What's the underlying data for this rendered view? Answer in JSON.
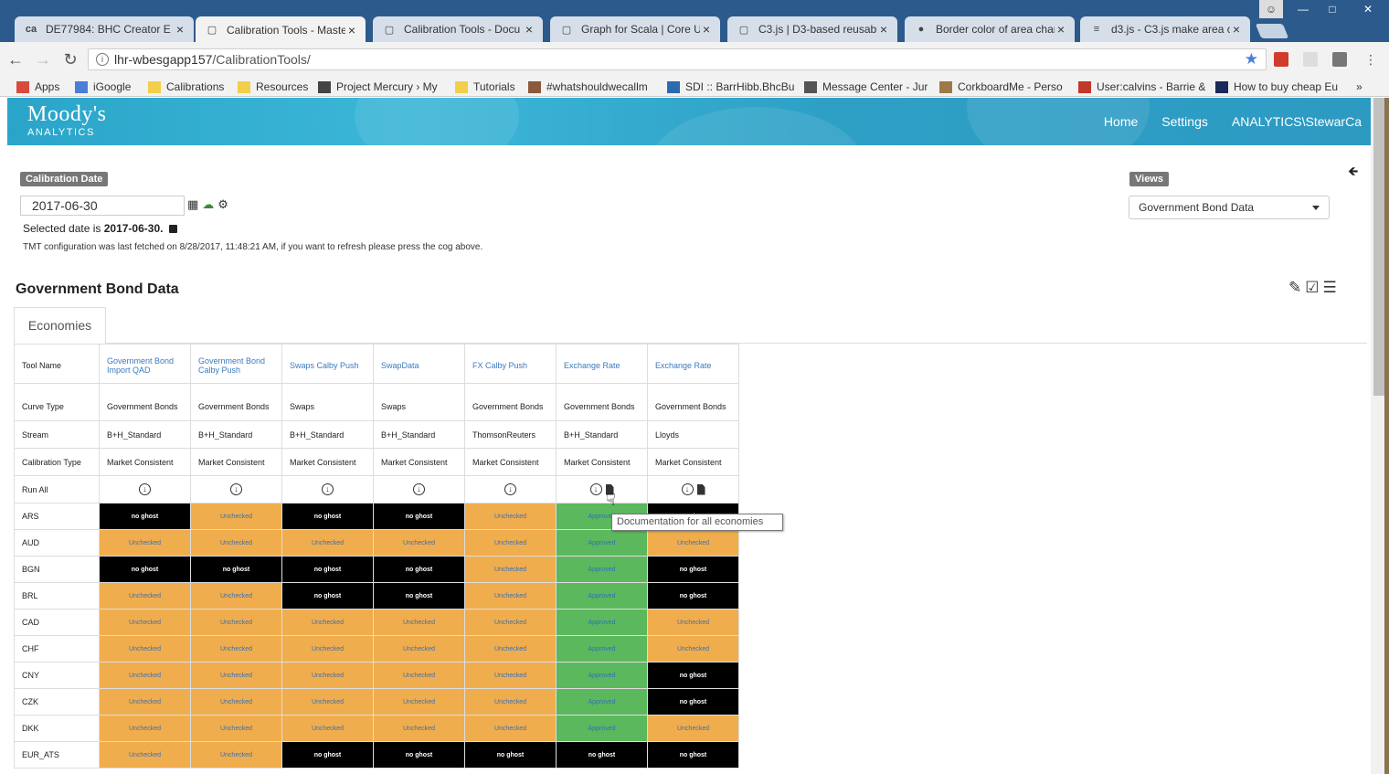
{
  "browser": {
    "tabs": [
      {
        "title": "DE77984: BHC Creator E",
        "icon": "ca-icon",
        "active": false
      },
      {
        "title": "Calibration Tools - Maste",
        "icon": "page-icon",
        "active": true
      },
      {
        "title": "Calibration Tools - Docu",
        "icon": "page-icon",
        "active": false
      },
      {
        "title": "Graph for Scala | Core Us",
        "icon": "page-icon",
        "active": false
      },
      {
        "title": "C3.js | D3-based reusable",
        "icon": "page-icon",
        "active": false
      },
      {
        "title": "Border color of area char",
        "icon": "github-icon",
        "active": false
      },
      {
        "title": "d3.js - C3.js make area cl",
        "icon": "stackoverflow-icon",
        "active": false
      }
    ],
    "url_host": "lhr-wbesgapp157",
    "url_path": "/CalibrationTools/",
    "bookmarks": [
      {
        "label": "Apps",
        "icon": "apps-icon"
      },
      {
        "label": "iGoogle",
        "icon": "google-icon"
      },
      {
        "label": "Calibrations",
        "icon": "folder-icon"
      },
      {
        "label": "Resources",
        "icon": "folder-icon"
      },
      {
        "label": "Project Mercury › My",
        "icon": "ca-icon"
      },
      {
        "label": "Tutorials",
        "icon": "folder-icon"
      },
      {
        "label": "#whatshouldwecallm",
        "icon": "image-icon"
      },
      {
        "label": "SDI :: BarrHibb.BhcBu",
        "icon": "tc-icon"
      },
      {
        "label": "Message Center - Jur",
        "icon": "note-icon"
      },
      {
        "label": "CorkboardMe - Perso",
        "icon": "cork-icon"
      },
      {
        "label": "User:calvins - Barrie &",
        "icon": "user-icon"
      },
      {
        "label": "How to buy cheap Eu",
        "icon": "seat61-icon"
      }
    ],
    "bookmarks_more": "»"
  },
  "header": {
    "logo_big": "Moody's",
    "logo_small": "ANALYTICS",
    "nav": [
      "Home",
      "Settings",
      "ANALYTICS\\StewarCa"
    ]
  },
  "calibration": {
    "label": "Calibration Date",
    "date_value": "2017-06-30",
    "selected_prefix": "Selected date is ",
    "selected_date": "2017-06-30.",
    "tmt_message": "TMT configuration was last fetched on 8/28/2017, 11:48:21 AM, if you want to refresh please press the cog above."
  },
  "views": {
    "label": "Views",
    "selected": "Government Bond Data"
  },
  "page_title": "Government Bond Data",
  "tabs": [
    "Economies"
  ],
  "grid": {
    "row_labels": [
      "Tool Name",
      "Curve Type",
      "Stream",
      "Calibration Type",
      "Run All"
    ],
    "columns": [
      {
        "tool": "Government Bond Import QAD",
        "curve": "Government Bonds",
        "stream": "B+H_Standard",
        "cal": "Market Consistent",
        "doc": false
      },
      {
        "tool": "Government Bond Calby Push",
        "curve": "Government Bonds",
        "stream": "B+H_Standard",
        "cal": "Market Consistent",
        "doc": false
      },
      {
        "tool": "Swaps Calby Push",
        "curve": "Swaps",
        "stream": "B+H_Standard",
        "cal": "Market Consistent",
        "doc": false
      },
      {
        "tool": "SwapData",
        "curve": "Swaps",
        "stream": "B+H_Standard",
        "cal": "Market Consistent",
        "doc": false
      },
      {
        "tool": "FX Calby Push",
        "curve": "Government Bonds",
        "stream": "ThomsonReuters",
        "cal": "Market Consistent",
        "doc": false
      },
      {
        "tool": "Exchange Rate",
        "curve": "Government Bonds",
        "stream": "B+H_Standard",
        "cal": "Market Consistent",
        "doc": true
      },
      {
        "tool": "Exchange Rate",
        "curve": "Government Bonds",
        "stream": "Lloyds",
        "cal": "Market Consistent",
        "doc": true
      }
    ],
    "status_text": {
      "G": "no ghost",
      "U": "Unchecked",
      "A": "Approved"
    },
    "economies": [
      {
        "name": "ARS",
        "cells": [
          "G",
          "U",
          "G",
          "G",
          "U",
          "A",
          "G"
        ]
      },
      {
        "name": "AUD",
        "cells": [
          "U",
          "U",
          "U",
          "U",
          "U",
          "A",
          "U"
        ]
      },
      {
        "name": "BGN",
        "cells": [
          "G",
          "G",
          "G",
          "G",
          "U",
          "A",
          "G"
        ]
      },
      {
        "name": "BRL",
        "cells": [
          "U",
          "U",
          "G",
          "G",
          "U",
          "A",
          "G"
        ]
      },
      {
        "name": "CAD",
        "cells": [
          "U",
          "U",
          "U",
          "U",
          "U",
          "A",
          "U"
        ]
      },
      {
        "name": "CHF",
        "cells": [
          "U",
          "U",
          "U",
          "U",
          "U",
          "A",
          "U"
        ]
      },
      {
        "name": "CNY",
        "cells": [
          "U",
          "U",
          "U",
          "U",
          "U",
          "A",
          "G"
        ]
      },
      {
        "name": "CZK",
        "cells": [
          "U",
          "U",
          "U",
          "U",
          "U",
          "A",
          "G"
        ]
      },
      {
        "name": "DKK",
        "cells": [
          "U",
          "U",
          "U",
          "U",
          "U",
          "A",
          "U"
        ]
      },
      {
        "name": "EUR_ATS",
        "cells": [
          "U",
          "U",
          "G",
          "G",
          "G",
          "G",
          "G"
        ]
      }
    ]
  },
  "tooltip": "Documentation for all economies"
}
